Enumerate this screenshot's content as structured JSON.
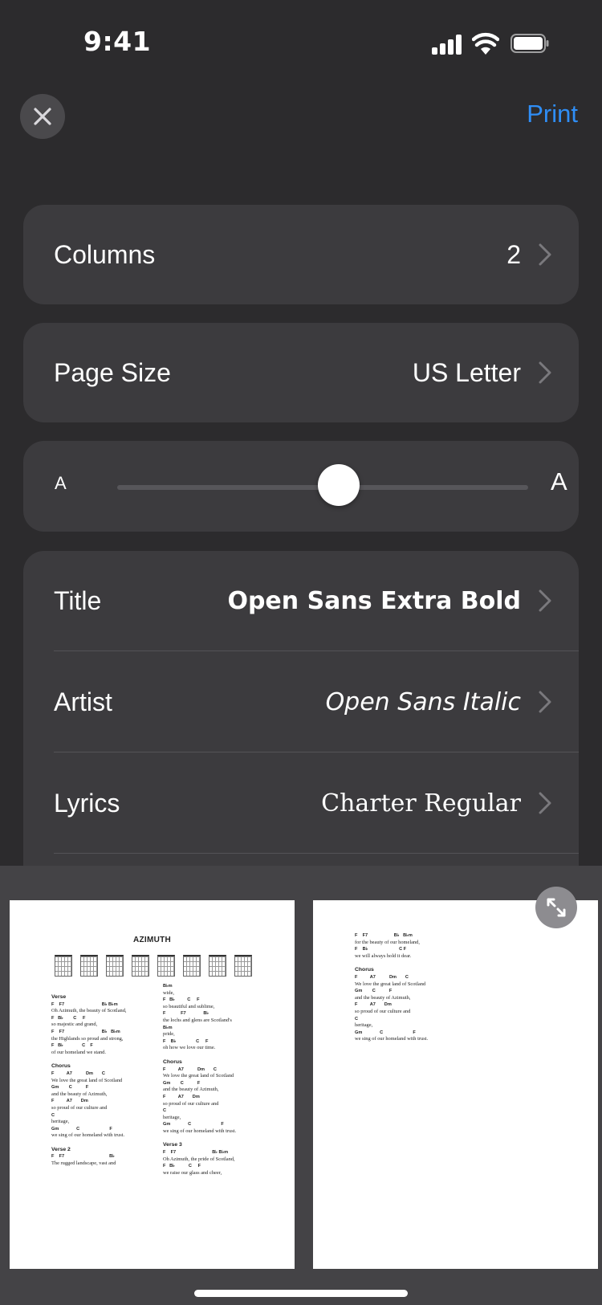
{
  "status_bar": {
    "time": "9:41"
  },
  "header": {
    "print_label": "Print"
  },
  "settings": {
    "columns": {
      "label": "Columns",
      "value": "2"
    },
    "page_size": {
      "label": "Page Size",
      "value": "US Letter"
    },
    "font_size_slider": {
      "min_label": "A",
      "max_label": "A",
      "level": 0.54
    },
    "fonts": [
      {
        "label": "Title",
        "value": "Open Sans Extra Bold"
      },
      {
        "label": "Artist",
        "value": "Open Sans Italic"
      },
      {
        "label": "Lyrics",
        "value": "Charter Regular"
      }
    ]
  },
  "preview": {
    "page1": {
      "title": "AZIMUTH",
      "left_column": [
        {
          "t": "s",
          "v": "Verse"
        },
        {
          "t": "c",
          "v": "F    F7                              B♭ B♭m"
        },
        {
          "t": "l",
          "v": "Oh Azimuth, the beauty of Scotland,"
        },
        {
          "t": "c",
          "v": "F   B♭        C     F"
        },
        {
          "t": "l",
          "v": "so majestic and grand,"
        },
        {
          "t": "c",
          "v": "F    F7                              B♭   B♭m"
        },
        {
          "t": "l",
          "v": "the Highlands so proud and strong,"
        },
        {
          "t": "c",
          "v": "F   B♭               C    F"
        },
        {
          "t": "l",
          "v": "of our homeland we stand."
        },
        {
          "t": "s",
          "v": "Chorus"
        },
        {
          "t": "c",
          "v": "F          A7           Dm       C"
        },
        {
          "t": "l",
          "v": "We love the great land of Scotland"
        },
        {
          "t": "c",
          "v": "Gm        C           F"
        },
        {
          "t": "l",
          "v": "and the beauty of Azimuth,"
        },
        {
          "t": "c",
          "v": "F          A7       Dm"
        },
        {
          "t": "l",
          "v": "so proud of our culture and"
        },
        {
          "t": "c",
          "v": "C"
        },
        {
          "t": "l",
          "v": "heritage,"
        },
        {
          "t": "c",
          "v": "Gm              C                        F"
        },
        {
          "t": "l",
          "v": "we sing of our homeland with trust."
        },
        {
          "t": "s",
          "v": "Verse 2"
        },
        {
          "t": "c",
          "v": "F    F7                                    B♭"
        },
        {
          "t": "l",
          "v": "The rugged landscape, vast and"
        }
      ],
      "right_column": [
        {
          "t": "c",
          "v": "B♭m"
        },
        {
          "t": "l",
          "v": "wide,"
        },
        {
          "t": "c",
          "v": "F   B♭          C     F"
        },
        {
          "t": "l",
          "v": "so beautiful and sublime,"
        },
        {
          "t": "c",
          "v": "F            F7              B♭"
        },
        {
          "t": "l",
          "v": "the lochs and glens are Scotland's"
        },
        {
          "t": "c",
          "v": "B♭m"
        },
        {
          "t": "l",
          "v": "pride,"
        },
        {
          "t": "c",
          "v": "F    B♭                C     F"
        },
        {
          "t": "l",
          "v": "oh how we love our time."
        },
        {
          "t": "s",
          "v": "Chorus"
        },
        {
          "t": "c",
          "v": "F          A7           Dm       C"
        },
        {
          "t": "l",
          "v": "We love the great land of Scotland"
        },
        {
          "t": "c",
          "v": "Gm        C           F"
        },
        {
          "t": "l",
          "v": "and the beauty of Azimuth,"
        },
        {
          "t": "c",
          "v": "F          A7       Dm"
        },
        {
          "t": "l",
          "v": "so proud of our culture and"
        },
        {
          "t": "c",
          "v": "C"
        },
        {
          "t": "l",
          "v": "heritage,"
        },
        {
          "t": "c",
          "v": "Gm              C                        F"
        },
        {
          "t": "l",
          "v": "we sing of our homeland with trust."
        },
        {
          "t": "s",
          "v": "Verse 3"
        },
        {
          "t": "c",
          "v": "F    F7                             B♭ B♭m"
        },
        {
          "t": "l",
          "v": "Oh Azimuth, the pride of Scotland,"
        },
        {
          "t": "c",
          "v": "F   B♭           C     F"
        },
        {
          "t": "l",
          "v": "we raise our glass and cheer,"
        }
      ]
    },
    "page2": {
      "column": [
        {
          "t": "c",
          "v": "F    F7                     B♭   B♭m"
        },
        {
          "t": "l",
          "v": "for the beauty of our homeland,"
        },
        {
          "t": "c",
          "v": "F    B♭                         C F"
        },
        {
          "t": "l",
          "v": "we will always hold it dear."
        },
        {
          "t": "s",
          "v": "Chorus"
        },
        {
          "t": "c",
          "v": "F          A7           Dm       C"
        },
        {
          "t": "l",
          "v": "We love the great land of Scotland"
        },
        {
          "t": "c",
          "v": "Gm        C           F"
        },
        {
          "t": "l",
          "v": "and the beauty of Azimuth,"
        },
        {
          "t": "c",
          "v": "F          A7       Dm"
        },
        {
          "t": "l",
          "v": "so proud of our culture and"
        },
        {
          "t": "c",
          "v": "C"
        },
        {
          "t": "l",
          "v": "heritage,"
        },
        {
          "t": "c",
          "v": "Gm              C                        F"
        },
        {
          "t": "l",
          "v": "we sing of our homeland with trust."
        }
      ]
    }
  }
}
